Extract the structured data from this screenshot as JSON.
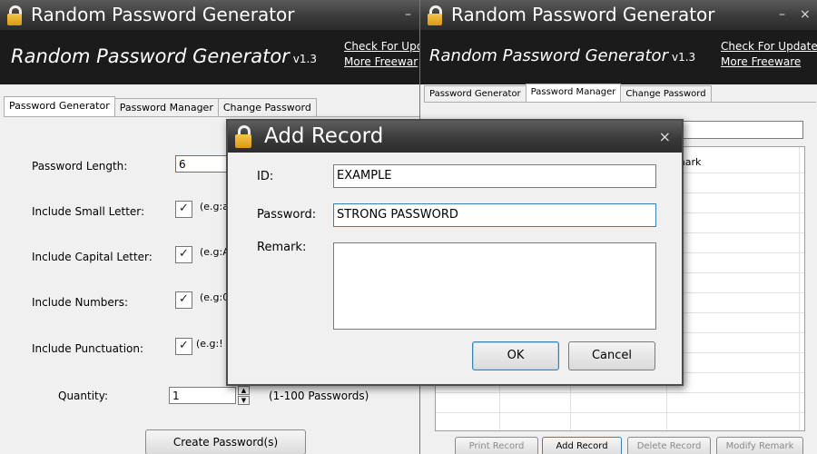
{
  "left_window": {
    "title": "Random Password Generator",
    "minimize": "–",
    "header": {
      "app_name": "Random Password Generator",
      "version": "v1.3",
      "link_update": "Check For Upd",
      "link_freeware": "More Freewar"
    },
    "tabs": [
      "Password Generator",
      "Password Manager",
      "Change Password"
    ],
    "form": {
      "length_label": "Password Length:",
      "length_value": "6",
      "small_label": "Include Small Letter:",
      "small_hint": "(e.g:a",
      "capital_label": "Include Capital Letter:",
      "capital_hint": "(e.g:A",
      "numbers_label": "Include Numbers:",
      "numbers_hint": "(e.g:0",
      "punct_label": "Include Punctuation:",
      "punct_hint": "(e.g:!",
      "quantity_label": "Quantity:",
      "quantity_value": "1",
      "quantity_hint": "(1-100 Passwords)",
      "create_button": "Create Password(s)"
    }
  },
  "right_window": {
    "title": "Random Password Generator",
    "minimize": "–",
    "close": "×",
    "header": {
      "app_name": "Random Password Generator",
      "version": "v1.3",
      "link_update": "Check For Update",
      "link_freeware": "More Freeware"
    },
    "tabs": [
      "Password Generator",
      "Password Manager",
      "Change Password"
    ],
    "grid_header_remark": "mark",
    "buttons": {
      "print": "Print Record",
      "add": "Add Record",
      "delete": "Delete Record",
      "modify": "Modify Remark"
    }
  },
  "dialog": {
    "title": "Add Record",
    "close": "×",
    "id_label": "ID:",
    "id_value": "EXAMPLE",
    "password_label": "Password:",
    "password_value": "STRONG PASSWORD",
    "remark_label": "Remark:",
    "remark_value": "",
    "ok": "OK",
    "cancel": "Cancel"
  },
  "checkmark": "✓",
  "colors": {
    "titlebar": "#3a3a3a",
    "header_bg": "#1b1b1b",
    "lock": "#e8b12c",
    "focus_border": "#3c7fb1"
  }
}
